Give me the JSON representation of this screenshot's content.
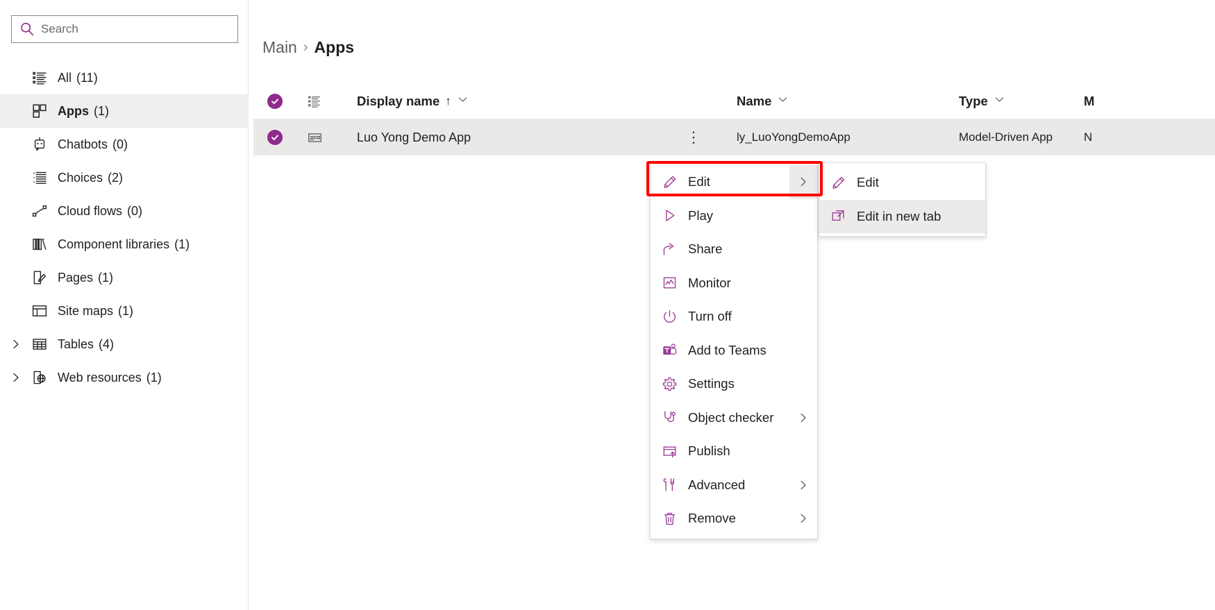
{
  "colors": {
    "accent": "#8e2a8b",
    "menu_icon": "#9b3a96",
    "highlight_box": "#ff0000",
    "row_selected_bg": "#ebe9e7",
    "nav_selected_bg": "#efefef"
  },
  "sidebar": {
    "search": {
      "placeholder": "Search",
      "value": "",
      "icon": "search-icon"
    },
    "items": [
      {
        "label": "All",
        "count": "(11)",
        "icon": "list-all-icon",
        "selected": false,
        "expandable": false
      },
      {
        "label": "Apps",
        "count": "(1)",
        "icon": "apps-grid-icon",
        "selected": true,
        "expandable": false
      },
      {
        "label": "Chatbots",
        "count": "(0)",
        "icon": "chatbot-icon",
        "selected": false,
        "expandable": false
      },
      {
        "label": "Choices",
        "count": "(2)",
        "icon": "choices-list-icon",
        "selected": false,
        "expandable": false
      },
      {
        "label": "Cloud flows",
        "count": "(0)",
        "icon": "cloud-flow-icon",
        "selected": false,
        "expandable": false
      },
      {
        "label": "Component libraries",
        "count": "(1)",
        "icon": "component-library-icon",
        "selected": false,
        "expandable": false
      },
      {
        "label": "Pages",
        "count": "(1)",
        "icon": "page-edit-icon",
        "selected": false,
        "expandable": false
      },
      {
        "label": "Site maps",
        "count": "(1)",
        "icon": "sitemap-icon",
        "selected": false,
        "expandable": false
      },
      {
        "label": "Tables",
        "count": "(4)",
        "icon": "table-icon",
        "selected": false,
        "expandable": true
      },
      {
        "label": "Web resources",
        "count": "(1)",
        "icon": "web-resource-icon",
        "selected": false,
        "expandable": true
      }
    ]
  },
  "breadcrumb": {
    "root": "Main",
    "separator": "›",
    "current": "Apps"
  },
  "table": {
    "headers": {
      "display_name": "Display name",
      "sort_indicator": "↑",
      "name": "Name",
      "type": "Type",
      "modified": "M"
    },
    "rows": [
      {
        "selected": true,
        "icon": "model-driven-app-icon",
        "display_name": "Luo Yong Demo App",
        "kebab": "⋮",
        "name": "ly_LuoYongDemoApp",
        "type": "Model-Driven App",
        "modified": "N"
      }
    ]
  },
  "context_menu": {
    "items": [
      {
        "label": "Edit",
        "icon": "pencil-icon",
        "submenu": true,
        "highlighted": true
      },
      {
        "label": "Play",
        "icon": "play-icon",
        "submenu": false,
        "highlighted": false
      },
      {
        "label": "Share",
        "icon": "share-icon",
        "submenu": false,
        "highlighted": false
      },
      {
        "label": "Monitor",
        "icon": "monitor-icon",
        "submenu": false,
        "highlighted": false
      },
      {
        "label": "Turn off",
        "icon": "power-icon",
        "submenu": false,
        "highlighted": false
      },
      {
        "label": "Add to Teams",
        "icon": "teams-icon",
        "submenu": false,
        "highlighted": false
      },
      {
        "label": "Settings",
        "icon": "gear-icon",
        "submenu": false,
        "highlighted": false
      },
      {
        "label": "Object checker",
        "icon": "stethoscope-icon",
        "submenu": true,
        "highlighted": false
      },
      {
        "label": "Publish",
        "icon": "publish-icon",
        "submenu": false,
        "highlighted": false
      },
      {
        "label": "Advanced",
        "icon": "advanced-icon",
        "submenu": true,
        "highlighted": false
      },
      {
        "label": "Remove",
        "icon": "trash-icon",
        "submenu": true,
        "highlighted": false
      }
    ]
  },
  "submenu": {
    "items": [
      {
        "label": "Edit",
        "icon": "pencil-icon",
        "active": false
      },
      {
        "label": "Edit in new tab",
        "icon": "new-window-icon",
        "active": true
      }
    ]
  }
}
